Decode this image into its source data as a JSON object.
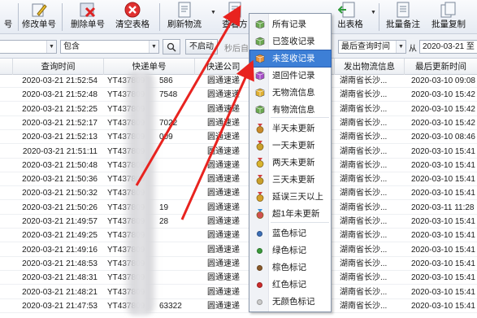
{
  "toolbar": {
    "buttons": [
      {
        "label": "号",
        "icon": "pencil-icon"
      },
      {
        "label": "修改单号",
        "icon": "pencil-icon"
      },
      {
        "label": "删除单号",
        "icon": "delete-icon"
      },
      {
        "label": "清空表格",
        "icon": "clear-table-icon"
      },
      {
        "label": "刷新物流",
        "icon": "refresh-doc-icon"
      },
      {
        "label": "查看方",
        "icon": "view-doc-icon"
      },
      {
        "label": "出表格",
        "icon": "export-table-icon"
      },
      {
        "label": "批量备注",
        "icon": "batch-note-icon"
      },
      {
        "label": "批量复制",
        "icon": "batch-copy-icon"
      }
    ]
  },
  "filterbar": {
    "combo1": "",
    "combo2": "包含",
    "search_value": "",
    "not_start": "不启动",
    "auto_after": "秒后自",
    "sort_field": "最后查询时间",
    "from_label": "从",
    "from_date": "2020-03-21  至"
  },
  "table": {
    "headers": [
      "查询时间",
      "快递单号",
      "快递公司",
      "",
      "发出物流信息",
      "最后更新时间"
    ],
    "rows": [
      {
        "time": "2020-03-21 21:52:54",
        "no": "YT437809",
        "tail": "586",
        "company": "圆通速递",
        "info": "湖南省长沙...",
        "update": "2020-03-10 09:08"
      },
      {
        "time": "2020-03-21 21:52:48",
        "no": "YT437809",
        "tail": "7548",
        "company": "圆通速递",
        "info": "湖南省长沙...",
        "update": "2020-03-10 15:42"
      },
      {
        "time": "2020-03-21 21:52:25",
        "no": "YT437809",
        "tail": "",
        "company": "圆通速递",
        "info": "湖南省长沙...",
        "update": "2020-03-10 15:42"
      },
      {
        "time": "2020-03-21 21:52:17",
        "no": "YT437809",
        "tail": "7022",
        "company": "圆通速递",
        "info": "湖南省长沙...",
        "update": "2020-03-10 15:42"
      },
      {
        "time": "2020-03-21 21:52:13",
        "no": "YT437809",
        "tail": "009",
        "company": "圆通速递",
        "info": "湖南省长沙...",
        "update": "2020-03-10 08:46"
      },
      {
        "time": "2020-03-21 21:51:11",
        "no": "YT437809",
        "tail": "",
        "company": "圆通速递",
        "info": "湖南省长沙...",
        "update": "2020-03-10 15:41"
      },
      {
        "time": "2020-03-21 21:50:48",
        "no": "YT437809",
        "tail": "",
        "company": "圆通速递",
        "info": "湖南省长沙...",
        "update": "2020-03-10 15:41"
      },
      {
        "time": "2020-03-21 21:50:36",
        "no": "YT437809",
        "tail": "",
        "company": "圆通速递",
        "info": "湖南省长沙...",
        "update": "2020-03-10 15:41"
      },
      {
        "time": "2020-03-21 21:50:32",
        "no": "YT437809",
        "tail": "",
        "company": "圆通速递",
        "info": "湖南省长沙...",
        "update": "2020-03-10 15:41"
      },
      {
        "time": "2020-03-21 21:50:26",
        "no": "YT437809",
        "tail": "19",
        "company": "圆通速递",
        "info": "湖南省长沙...",
        "update": "2020-03-11 11:28"
      },
      {
        "time": "2020-03-21 21:49:57",
        "no": "YT437809",
        "tail": "28",
        "company": "圆通速递",
        "info": "湖南省长沙...",
        "update": "2020-03-10 15:41"
      },
      {
        "time": "2020-03-21 21:49:25",
        "no": "YT437809",
        "tail": "",
        "company": "圆通速递",
        "info": "湖南省长沙...",
        "update": "2020-03-10 15:41"
      },
      {
        "time": "2020-03-21 21:49:16",
        "no": "YT437809",
        "tail": "",
        "company": "圆通速递",
        "info": "湖南省长沙...",
        "update": "2020-03-10 15:41"
      },
      {
        "time": "2020-03-21 21:48:53",
        "no": "YT437809",
        "tail": "",
        "company": "圆通速递",
        "info": "湖南省长沙...",
        "update": "2020-03-10 15:41"
      },
      {
        "time": "2020-03-21 21:48:31",
        "no": "YT437809",
        "tail": "",
        "company": "圆通速递",
        "info": "湖南省长沙...",
        "update": "2020-03-10 15:41"
      },
      {
        "time": "2020-03-21 21:48:21",
        "no": "YT437809",
        "tail": "",
        "company": "圆通速递",
        "info": "湖南省长沙...",
        "update": "2020-03-10 15:41"
      },
      {
        "time": "2020-03-21 21:47:53",
        "no": "YT437809",
        "tail": "63322",
        "company": "圆通速递",
        "info": "湖南省长沙...",
        "update": "2020-03-10 15:41"
      }
    ]
  },
  "menu": {
    "items": [
      {
        "label": "所有记录",
        "icon": "all-records-icon",
        "color": "#6aa84f"
      },
      {
        "label": "已签收记录",
        "icon": "signed-records-icon",
        "color": "#6aa84f"
      },
      {
        "label": "未签收记录",
        "icon": "unsigned-records-icon",
        "color": "#e69138"
      },
      {
        "label": "退回件记录",
        "icon": "returned-records-icon",
        "color": "#a64dc8"
      },
      {
        "label": "无物流信息",
        "icon": "no-logistics-icon",
        "color": "#e0b030"
      },
      {
        "label": "有物流信息",
        "icon": "has-logistics-icon",
        "color": "#6aa84f"
      },
      {
        "label": "半天未更新",
        "icon": "half-day-medal-icon",
        "color": "#c98a2b"
      },
      {
        "label": "一天未更新",
        "icon": "one-day-medal-icon",
        "color": "#c9a02b"
      },
      {
        "label": "两天未更新",
        "icon": "two-day-medal-icon",
        "color": "#d9b52e"
      },
      {
        "label": "三天未更新",
        "icon": "three-day-medal-icon",
        "color": "#c9a02b"
      },
      {
        "label": "延误三天以上",
        "icon": "delay-medal-icon",
        "color": "#d4a12a"
      },
      {
        "label": "超1年未更新",
        "icon": "one-year-medal-icon",
        "color": "#d05050"
      },
      {
        "label": "蓝色标记",
        "icon": "blue-dot-icon",
        "color": "#3d6fb6"
      },
      {
        "label": "绿色标记",
        "icon": "green-dot-icon",
        "color": "#3a9a3a"
      },
      {
        "label": "棕色标记",
        "icon": "brown-dot-icon",
        "color": "#8a5a2a"
      },
      {
        "label": "红色标记",
        "icon": "red-dot-icon",
        "color": "#cc2b2b"
      },
      {
        "label": "无颜色标记",
        "icon": "no-color-dot-icon",
        "color": "#cccccc"
      }
    ],
    "selected_index": 2
  },
  "colors": {
    "arrow": "#e8231f",
    "menu_highlight": "#3d7fd6"
  }
}
